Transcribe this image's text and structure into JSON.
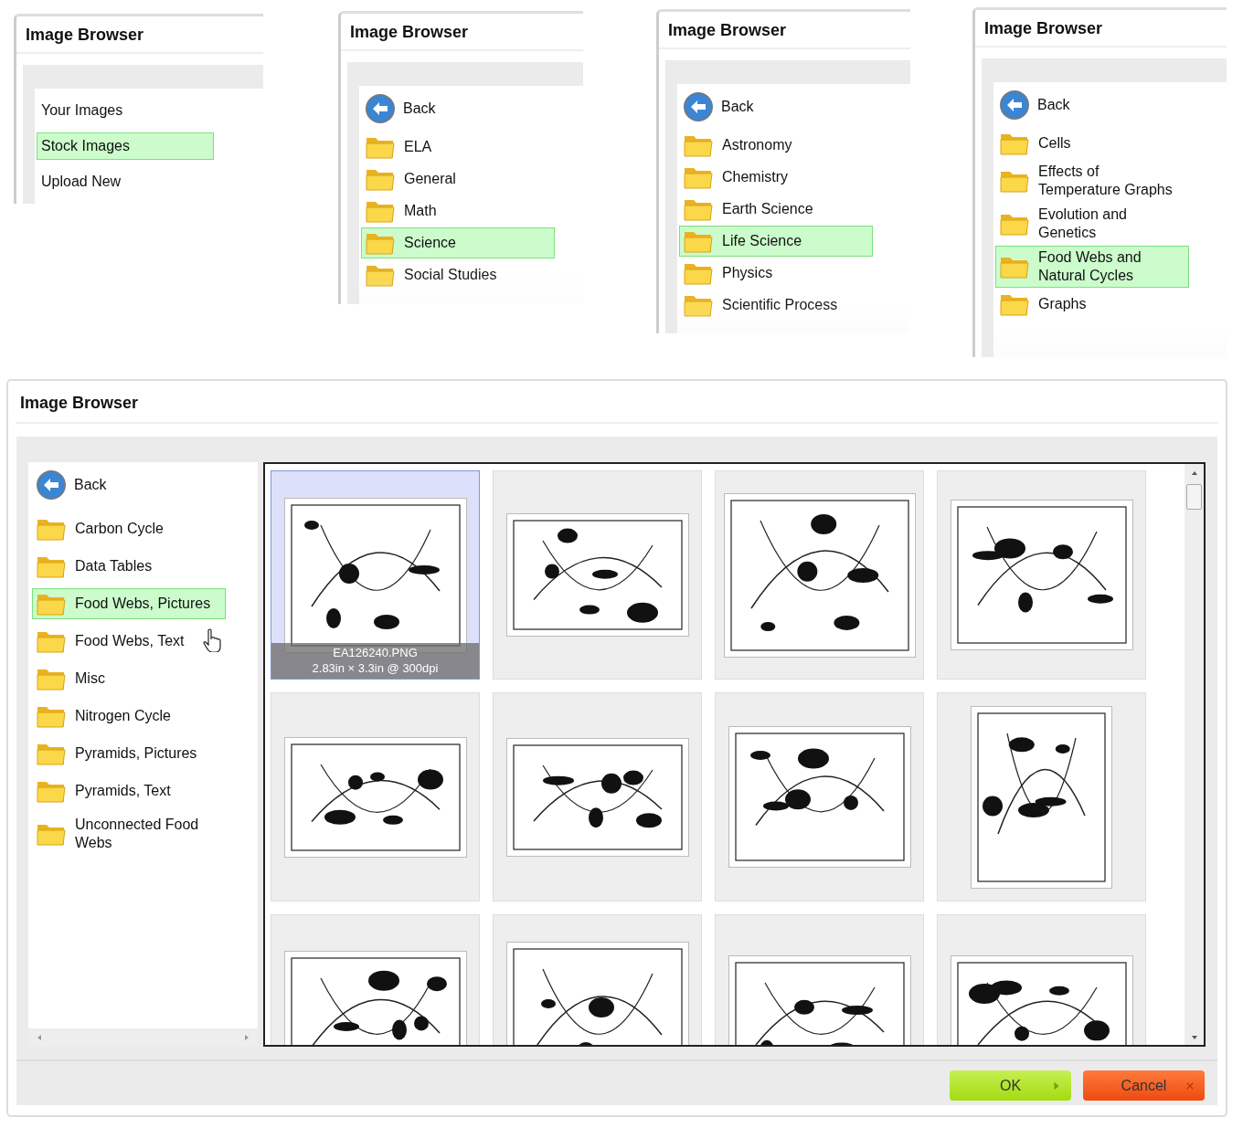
{
  "steps": [
    {
      "title": "Image Browser",
      "items": [
        {
          "kind": "text",
          "label": "Your Images",
          "selected": false
        },
        {
          "kind": "text",
          "label": "Stock Images",
          "selected": true
        },
        {
          "kind": "text",
          "label": "Upload New",
          "selected": false
        }
      ]
    },
    {
      "title": "Image Browser",
      "items": [
        {
          "kind": "back",
          "label": "Back"
        },
        {
          "kind": "folder",
          "label": "ELA",
          "selected": false
        },
        {
          "kind": "folder",
          "label": "General",
          "selected": false
        },
        {
          "kind": "folder",
          "label": "Math",
          "selected": false
        },
        {
          "kind": "folder",
          "label": "Science",
          "selected": true
        },
        {
          "kind": "folder",
          "label": "Social Studies",
          "selected": false
        }
      ]
    },
    {
      "title": "Image Browser",
      "items": [
        {
          "kind": "back",
          "label": "Back"
        },
        {
          "kind": "folder",
          "label": "Astronomy",
          "selected": false
        },
        {
          "kind": "folder",
          "label": "Chemistry",
          "selected": false
        },
        {
          "kind": "folder",
          "label": "Earth Science",
          "selected": false
        },
        {
          "kind": "folder",
          "label": "Life Science",
          "selected": true
        },
        {
          "kind": "folder",
          "label": "Physics",
          "selected": false
        },
        {
          "kind": "folder",
          "label": "Scientific Process",
          "selected": false
        }
      ]
    },
    {
      "title": "Image Browser",
      "items": [
        {
          "kind": "back",
          "label": "Back"
        },
        {
          "kind": "folder",
          "label": "Cells",
          "selected": false
        },
        {
          "kind": "folder",
          "label": "Effects of Temperature Graphs",
          "selected": false
        },
        {
          "kind": "folder",
          "label": "Evolution and Genetics",
          "selected": false
        },
        {
          "kind": "folder",
          "label": "Food Webs and Natural Cycles",
          "selected": true
        },
        {
          "kind": "folder",
          "label": "Graphs",
          "selected": false
        }
      ]
    }
  ],
  "dialog": {
    "title": "Image Browser",
    "folders": [
      {
        "kind": "back",
        "label": "Back"
      },
      {
        "kind": "folder",
        "label": "Carbon Cycle",
        "selected": false
      },
      {
        "kind": "folder",
        "label": "Data Tables",
        "selected": false
      },
      {
        "kind": "folder",
        "label": "Food Webs, Pictures",
        "selected": true
      },
      {
        "kind": "folder",
        "label": "Food Webs, Text",
        "selected": false
      },
      {
        "kind": "folder",
        "label": "Misc",
        "selected": false
      },
      {
        "kind": "folder",
        "label": "Nitrogen Cycle",
        "selected": false
      },
      {
        "kind": "folder",
        "label": "Pyramids, Pictures",
        "selected": false
      },
      {
        "kind": "folder",
        "label": "Pyramids, Text",
        "selected": false
      },
      {
        "kind": "folder",
        "label": "Unconnected Food Webs",
        "selected": false
      }
    ],
    "thumbnails": [
      {
        "kind": "picture",
        "selected": true,
        "filename": "EA126240.PNG",
        "size": "2.83in × 3.3in @ 300dpi"
      },
      {
        "kind": "picture",
        "selected": false
      },
      {
        "kind": "picture",
        "selected": false
      },
      {
        "kind": "picture",
        "selected": false
      },
      {
        "kind": "picture",
        "selected": false
      },
      {
        "kind": "picture",
        "selected": false
      },
      {
        "kind": "picture",
        "selected": false
      },
      {
        "kind": "picture",
        "selected": false
      },
      {
        "kind": "picture",
        "selected": false
      },
      {
        "kind": "picture",
        "selected": false
      },
      {
        "kind": "picture",
        "selected": false
      },
      {
        "kind": "picture",
        "selected": false
      }
    ],
    "buttons": [
      {
        "kind": "ok",
        "label": "OK"
      },
      {
        "kind": "cancel",
        "label": "Cancel"
      }
    ]
  }
}
